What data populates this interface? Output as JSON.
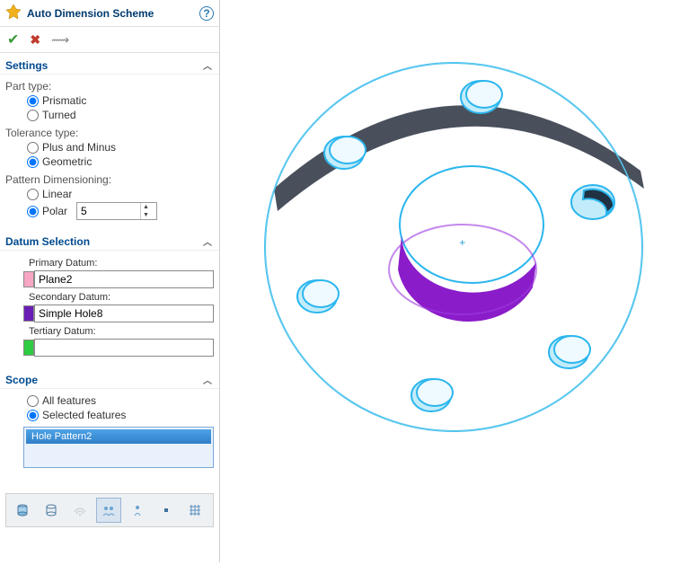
{
  "header": {
    "title": "Auto Dimension Scheme"
  },
  "sections": {
    "settings": {
      "title": "Settings",
      "partTypeLabel": "Part type:",
      "partType": {
        "prismatic": "Prismatic",
        "turned": "Turned",
        "selected": "prismatic"
      },
      "toleranceLabel": "Tolerance type:",
      "tolerance": {
        "plusMinus": "Plus and Minus",
        "geometric": "Geometric",
        "selected": "geometric"
      },
      "patternLabel": "Pattern Dimensioning:",
      "pattern": {
        "linear": "Linear",
        "polar": "Polar",
        "selected": "polar",
        "value": "5"
      }
    },
    "datum": {
      "title": "Datum Selection",
      "primaryLabel": "Primary Datum:",
      "primaryValue": "Plane2",
      "primaryColor": "#f7a6c3",
      "secondaryLabel": "Secondary Datum:",
      "secondaryValue": "Simple Hole8",
      "secondaryColor": "#6a1db5",
      "tertiaryLabel": "Tertiary Datum:",
      "tertiaryValue": "",
      "tertiaryColor": "#2ecc40"
    },
    "scope": {
      "title": "Scope",
      "all": "All features",
      "selected": "Selected features",
      "choice": "selected",
      "items": [
        "Hole Pattern2"
      ]
    }
  },
  "toolbar": {
    "icons": [
      "cylinder",
      "cyl-outline",
      "wifi",
      "group",
      "datum",
      "point",
      "grid"
    ],
    "activeIndex": 3
  }
}
